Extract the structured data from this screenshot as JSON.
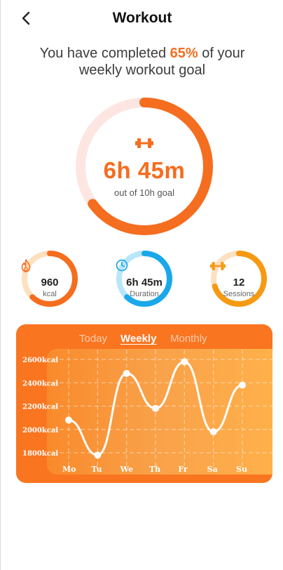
{
  "header": {
    "title": "Workout",
    "back_icon": "chevron-left-icon"
  },
  "summary": {
    "prefix": "You have completed ",
    "percent": "65%",
    "suffix_line1": " of your",
    "line2": "weekly workout goal"
  },
  "goal_ring": {
    "progress": 0.65,
    "value": "6h 45m",
    "sub": "out of 10h goal",
    "icon": "dumbbell-icon",
    "colors": {
      "track": "#fde6e1",
      "fill": "#f56d1f"
    }
  },
  "stats": [
    {
      "icon": "flame-icon",
      "value": "960",
      "label": "kcal",
      "progress": 0.62,
      "track": "#fde0bf",
      "fill": "#f56d1f"
    },
    {
      "icon": "clock-icon",
      "value": "6h 45m",
      "label": "Duration",
      "progress": 0.62,
      "track": "#b9e6fb",
      "fill": "#1aa8ea"
    },
    {
      "icon": "dumbbell-icon",
      "value": "12",
      "label": "Sessions",
      "progress": 0.7,
      "track": "#fde0bf",
      "fill": "#f59a12"
    }
  ],
  "chart_tabs": [
    {
      "label": "Today",
      "active": false
    },
    {
      "label": "Weekly",
      "active": true
    },
    {
      "label": "Monthly",
      "active": false
    }
  ],
  "chart_data": {
    "type": "line",
    "categories": [
      "Mo",
      "Tu",
      "We",
      "Th",
      "Fr",
      "Sa",
      "Su"
    ],
    "series": [
      {
        "values": [
          2080,
          1780,
          2480,
          2180,
          2580,
          1980,
          2380
        ]
      }
    ],
    "yticks": [
      "1800kcal",
      "2000kcal",
      "2200kcal",
      "2400kcal",
      "2600kcal"
    ],
    "ylim": [
      1800,
      2600
    ],
    "grid": true,
    "colors": {
      "card": "#f97520",
      "line": "#ffffff",
      "grid": "rgba(255,255,255,0.45)"
    }
  }
}
